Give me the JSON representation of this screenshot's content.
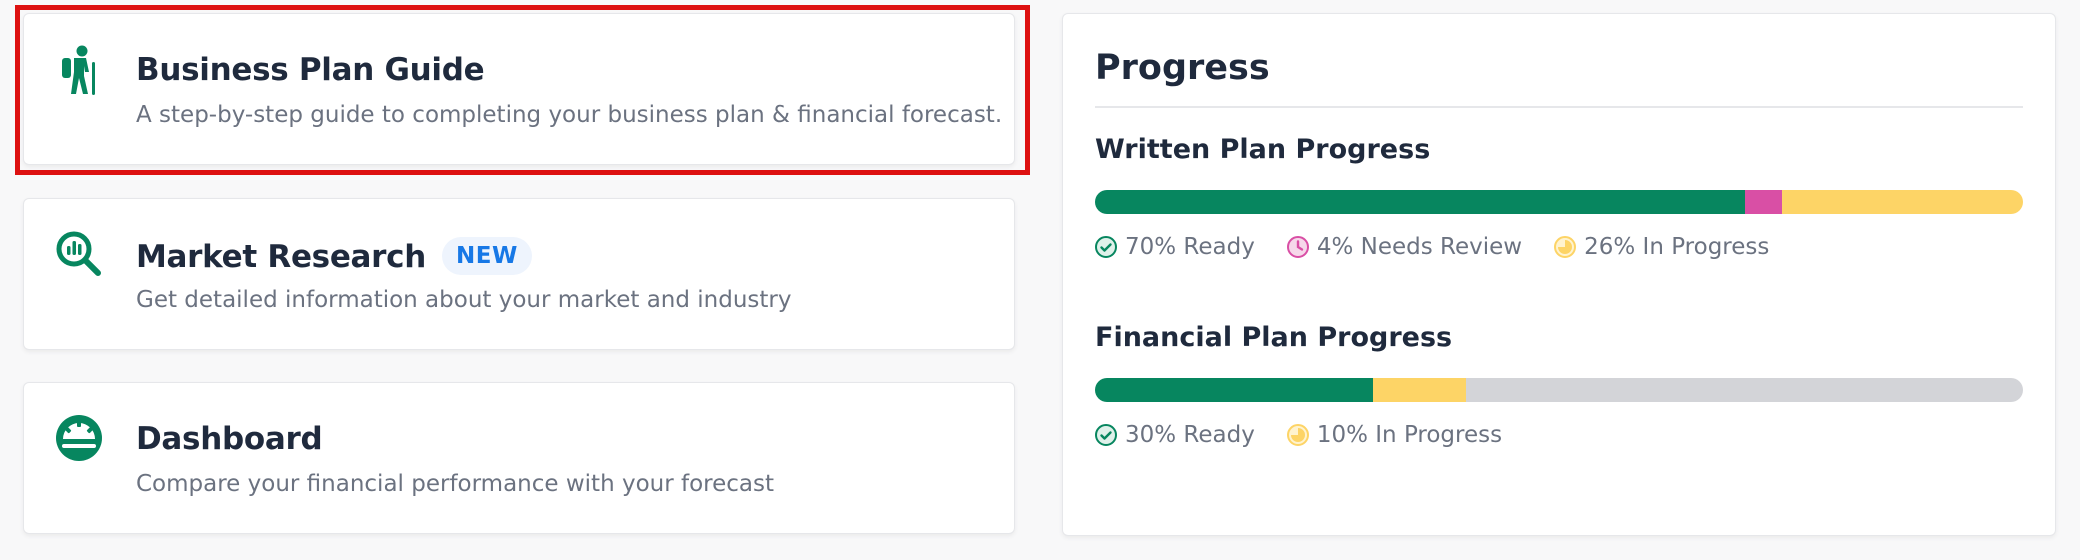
{
  "nav": {
    "guide": {
      "title": "Business Plan Guide",
      "description": "A step-by-step guide to completing your business plan & financial forecast.",
      "icon": "hiker-icon"
    },
    "market": {
      "title": "Market Research",
      "badge": "NEW",
      "description": "Get detailed information about your market and industry",
      "icon": "magnifier-chart-icon"
    },
    "dashboard": {
      "title": "Dashboard",
      "description": "Compare your financial performance with your forecast",
      "icon": "gauge-icon"
    }
  },
  "progress": {
    "heading": "Progress",
    "written": {
      "title": "Written Plan Progress",
      "ready_pct": 70,
      "review_pct": 4,
      "in_progress_pct": 26,
      "ready_label": "70% Ready",
      "review_label": "4% Needs Review",
      "in_progress_label": "26% In Progress"
    },
    "financial": {
      "title": "Financial Plan Progress",
      "ready_pct": 30,
      "in_progress_pct": 10,
      "ready_label": "30% Ready",
      "in_progress_label": "10% In Progress"
    }
  },
  "colors": {
    "ready": "#07865f",
    "review": "#d94fa5",
    "in_progress": "#fdd466",
    "empty": "#d3d4d8",
    "brand_icon": "#07865f",
    "badge_text": "#1778e6",
    "highlight": "#dd1111"
  }
}
